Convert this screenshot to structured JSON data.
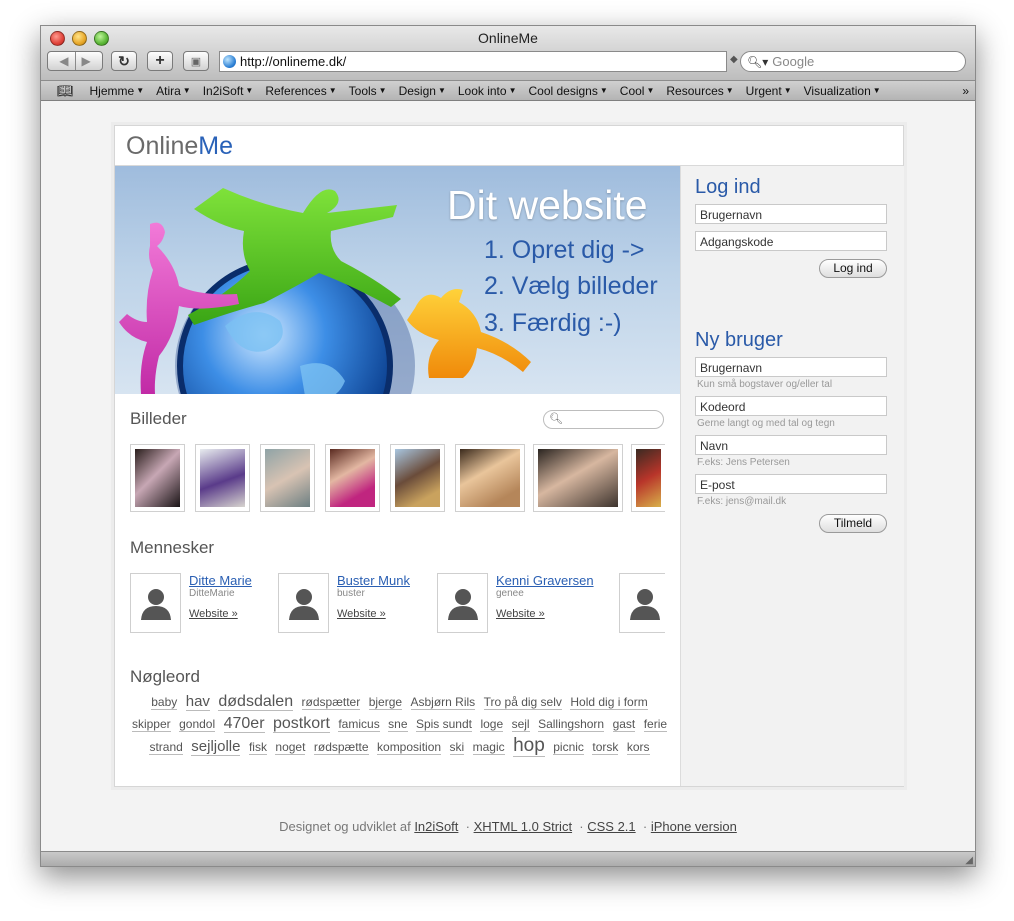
{
  "window": {
    "title": "OnlineMe"
  },
  "toolbar": {
    "address": "http://onlineme.dk/",
    "search_placeholder": "Google"
  },
  "bookmarks": [
    "Hjemme",
    "Atira",
    "In2iSoft",
    "References",
    "Tools",
    "Design",
    "Look into",
    "Cool designs",
    "Cool",
    "Resources",
    "Urgent",
    "Visualization"
  ],
  "logo": {
    "part1": "Online",
    "part2": "Me"
  },
  "hero": {
    "title": "Dit website",
    "step1": "1. Opret dig ->",
    "step2": "2. Vælg billeder",
    "step3": "3. Færdig :-)"
  },
  "login": {
    "heading": "Log ind",
    "username_placeholder": "Brugernavn",
    "password_placeholder": "Adgangskode",
    "button": "Log ind"
  },
  "signup": {
    "heading": "Ny bruger",
    "username_placeholder": "Brugernavn",
    "username_hint": "Kun små bogstaver og/eller tal",
    "password_placeholder": "Kodeord",
    "password_hint": "Gerne langt og med tal og tegn",
    "name_placeholder": "Navn",
    "name_hint": "F.eks: Jens Petersen",
    "email_placeholder": "E-post",
    "email_hint": "F.eks: jens@mail.dk",
    "button": "Tilmeld"
  },
  "pictures": {
    "heading": "Billeder"
  },
  "people": {
    "heading": "Mennesker",
    "items": [
      {
        "name": "Ditte Marie",
        "username": "DitteMarie",
        "link": "Website »"
      },
      {
        "name": "Buster Munk",
        "username": "buster",
        "link": "Website »"
      },
      {
        "name": "Kenni Graversen",
        "username": "genee",
        "link": "Website »"
      }
    ]
  },
  "keywords": {
    "heading": "Nøgleord",
    "tags": [
      {
        "t": "baby",
        "s": 12
      },
      {
        "t": "hav",
        "s": 15
      },
      {
        "t": "dødsdalen",
        "s": 16
      },
      {
        "t": "rødspætter",
        "s": 12
      },
      {
        "t": "bjerge",
        "s": 12
      },
      {
        "t": "Asbjørn Rils",
        "s": 12
      },
      {
        "t": "Tro på dig selv",
        "s": 12
      },
      {
        "t": "Hold dig i form",
        "s": 12
      },
      {
        "t": "skipper",
        "s": 12
      },
      {
        "t": "gondol",
        "s": 12
      },
      {
        "t": "470er",
        "s": 16
      },
      {
        "t": "postkort",
        "s": 16
      },
      {
        "t": "famicus",
        "s": 12
      },
      {
        "t": "sne",
        "s": 12
      },
      {
        "t": "Spis sundt",
        "s": 12
      },
      {
        "t": "loge",
        "s": 12
      },
      {
        "t": "sejl",
        "s": 12
      },
      {
        "t": "Sallingshorn",
        "s": 12
      },
      {
        "t": "gast",
        "s": 12
      },
      {
        "t": "ferie",
        "s": 12
      },
      {
        "t": "strand",
        "s": 12
      },
      {
        "t": "sejljolle",
        "s": 15
      },
      {
        "t": "fisk",
        "s": 12
      },
      {
        "t": "noget",
        "s": 12
      },
      {
        "t": "rødspætte",
        "s": 12
      },
      {
        "t": "komposition",
        "s": 12
      },
      {
        "t": "ski",
        "s": 12
      },
      {
        "t": "magic",
        "s": 12
      },
      {
        "t": "hop",
        "s": 19
      },
      {
        "t": "picnic",
        "s": 12
      },
      {
        "t": "torsk",
        "s": 12
      },
      {
        "t": "kors",
        "s": 12
      }
    ]
  },
  "footer": {
    "prefix": "Designet og udviklet af",
    "link1": "In2iSoft",
    "link2": "XHTML 1.0 Strict",
    "link3": "CSS 2.1",
    "link4": "iPhone version"
  }
}
